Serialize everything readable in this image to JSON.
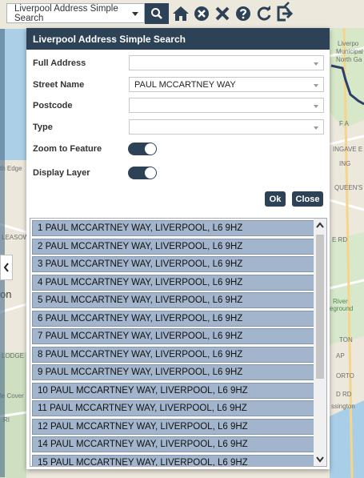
{
  "toolbar": {
    "search_select_value": "Liverpool Address Simple Search",
    "icons": [
      "search-icon",
      "home-icon",
      "clear-icon",
      "close-icon",
      "help-icon",
      "refresh-icon",
      "logout-icon"
    ]
  },
  "map": {
    "labels": {
      "liverpool_municipal": "Liverpool Municipal North Ge",
      "row2": "Liverpo",
      "row3": "Municipal",
      "row4": "North Ga",
      "ingave": "INGAVE E",
      "queens": "QUEEN'S DR",
      "north_edge": "th Edge",
      "leasowe": "LEASOWE",
      "on": "on",
      "e_rd": "E RD",
      "riverside": "River",
      "ground": "eground",
      "lodge": "LODGE",
      "le_cover": "le Cover",
      "ssington": "ssington",
      "ri": "RI",
      "d_rd": "D RD",
      "orto": "ORTO",
      "fa": "F A",
      "ing": "ING",
      "ap": "AP",
      "ton": "TON"
    }
  },
  "panel": {
    "title": "Liverpool Address Simple Search",
    "full_address_label": "Full Address",
    "full_address_value": "",
    "street_name_label": "Street Name",
    "street_name_value": "PAUL MCCARTNEY WAY",
    "postcode_label": "Postcode",
    "postcode_value": "",
    "type_label": "Type",
    "type_value": "",
    "zoom_label": "Zoom to Feature",
    "display_layer_label": "Display Layer",
    "ok_label": "Ok",
    "close_label": "Close"
  },
  "results": [
    "1 PAUL MCCARTNEY WAY, LIVERPOOL, L6 9HZ",
    "2 PAUL MCCARTNEY WAY, LIVERPOOL, L6 9HZ",
    "3 PAUL MCCARTNEY WAY, LIVERPOOL, L6 9HZ",
    "4 PAUL MCCARTNEY WAY, LIVERPOOL, L6 9HZ",
    "5 PAUL MCCARTNEY WAY, LIVERPOOL, L6 9HZ",
    "6 PAUL MCCARTNEY WAY, LIVERPOOL, L6 9HZ",
    "7 PAUL MCCARTNEY WAY, LIVERPOOL, L6 9HZ",
    "8 PAUL MCCARTNEY WAY, LIVERPOOL, L6 9HZ",
    "9 PAUL MCCARTNEY WAY, LIVERPOOL, L6 9HZ",
    "10 PAUL MCCARTNEY WAY, LIVERPOOL, L6 9HZ",
    "11 PAUL MCCARTNEY WAY, LIVERPOOL, L6 9HZ",
    "12 PAUL MCCARTNEY WAY, LIVERPOOL, L6 9HZ",
    "14 PAUL MCCARTNEY WAY, LIVERPOOL, L6 9HZ",
    "15 PAUL MCCARTNEY WAY, LIVERPOOL, L6 9HZ"
  ],
  "colors": {
    "header": "#2e4257",
    "result_fill": "#a2b5cc",
    "toggle_on": "#2e4257"
  },
  "toggles": {
    "zoom_to_feature": true,
    "display_layer": true
  }
}
